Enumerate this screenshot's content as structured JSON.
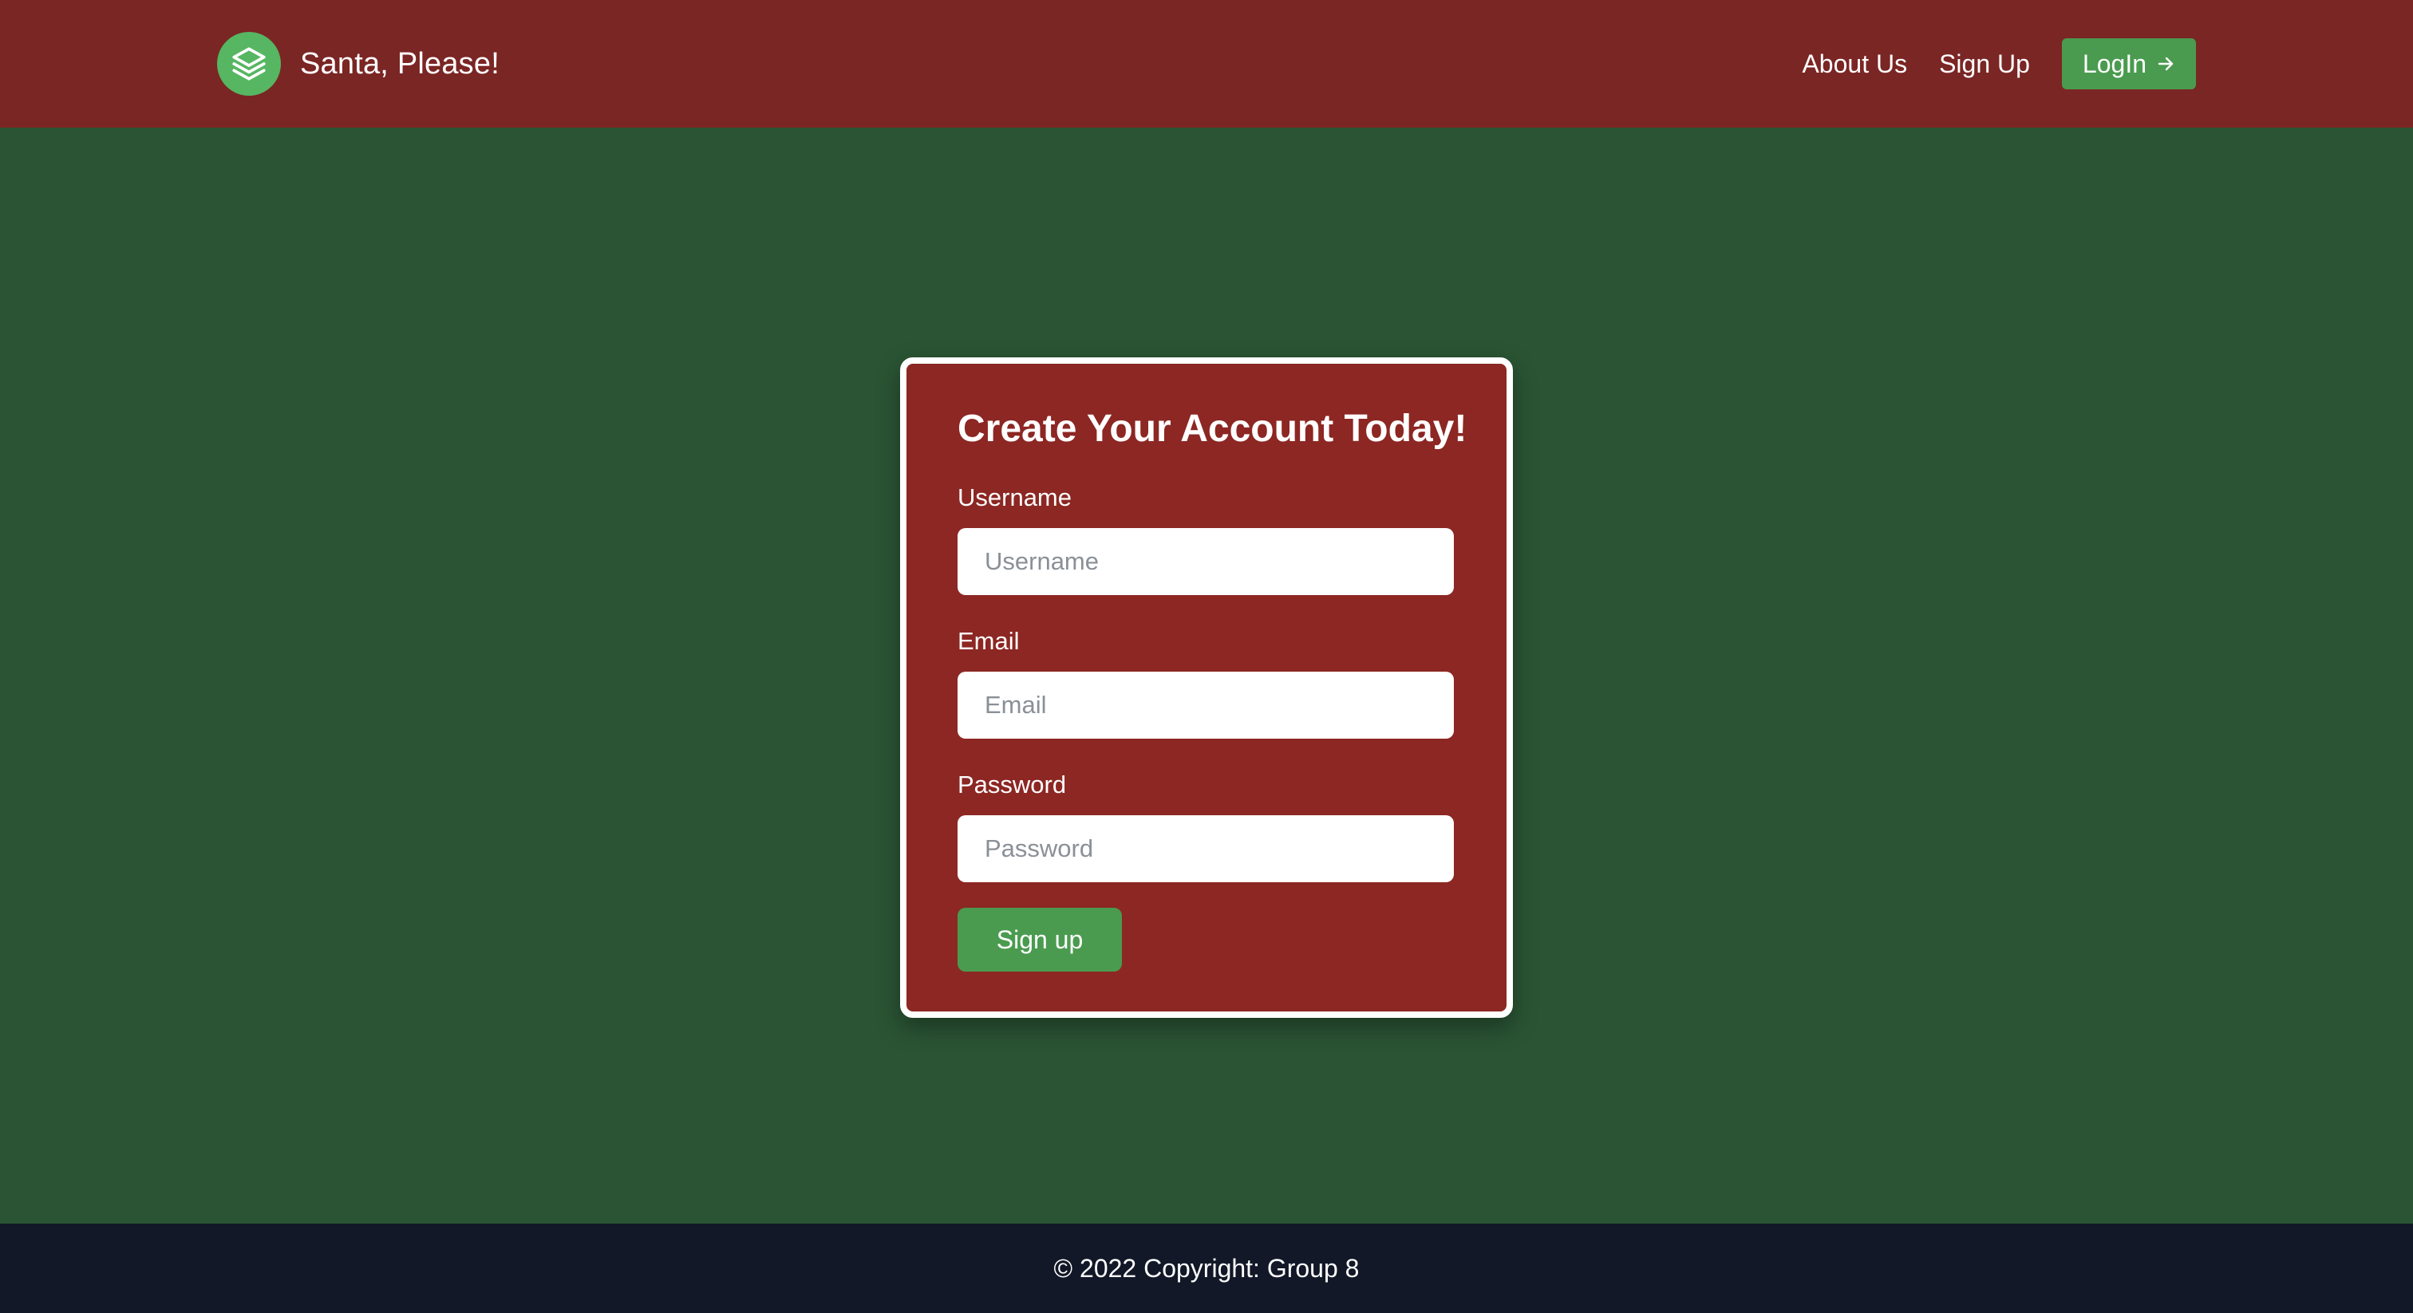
{
  "header": {
    "brand_name": "Santa, Please!",
    "brand_icon": "stack-layers-icon",
    "nav": {
      "about_label": "About Us",
      "signup_label": "Sign Up",
      "login_label": "LogIn",
      "login_icon": "arrow-right-icon"
    }
  },
  "form": {
    "title": "Create Your Account Today!",
    "username": {
      "label": "Username",
      "placeholder": "Username",
      "value": ""
    },
    "email": {
      "label": "Email",
      "placeholder": "Email",
      "value": ""
    },
    "password": {
      "label": "Password",
      "placeholder": "Password",
      "value": ""
    },
    "submit_label": "Sign up"
  },
  "footer": {
    "copyright": "© 2022 Copyright: Group 8"
  },
  "colors": {
    "navbar": "#7a2624",
    "page_background": "#2a5434",
    "card_background": "#8c2723",
    "accent_green": "#4a9b4f",
    "footer": "#121827"
  }
}
